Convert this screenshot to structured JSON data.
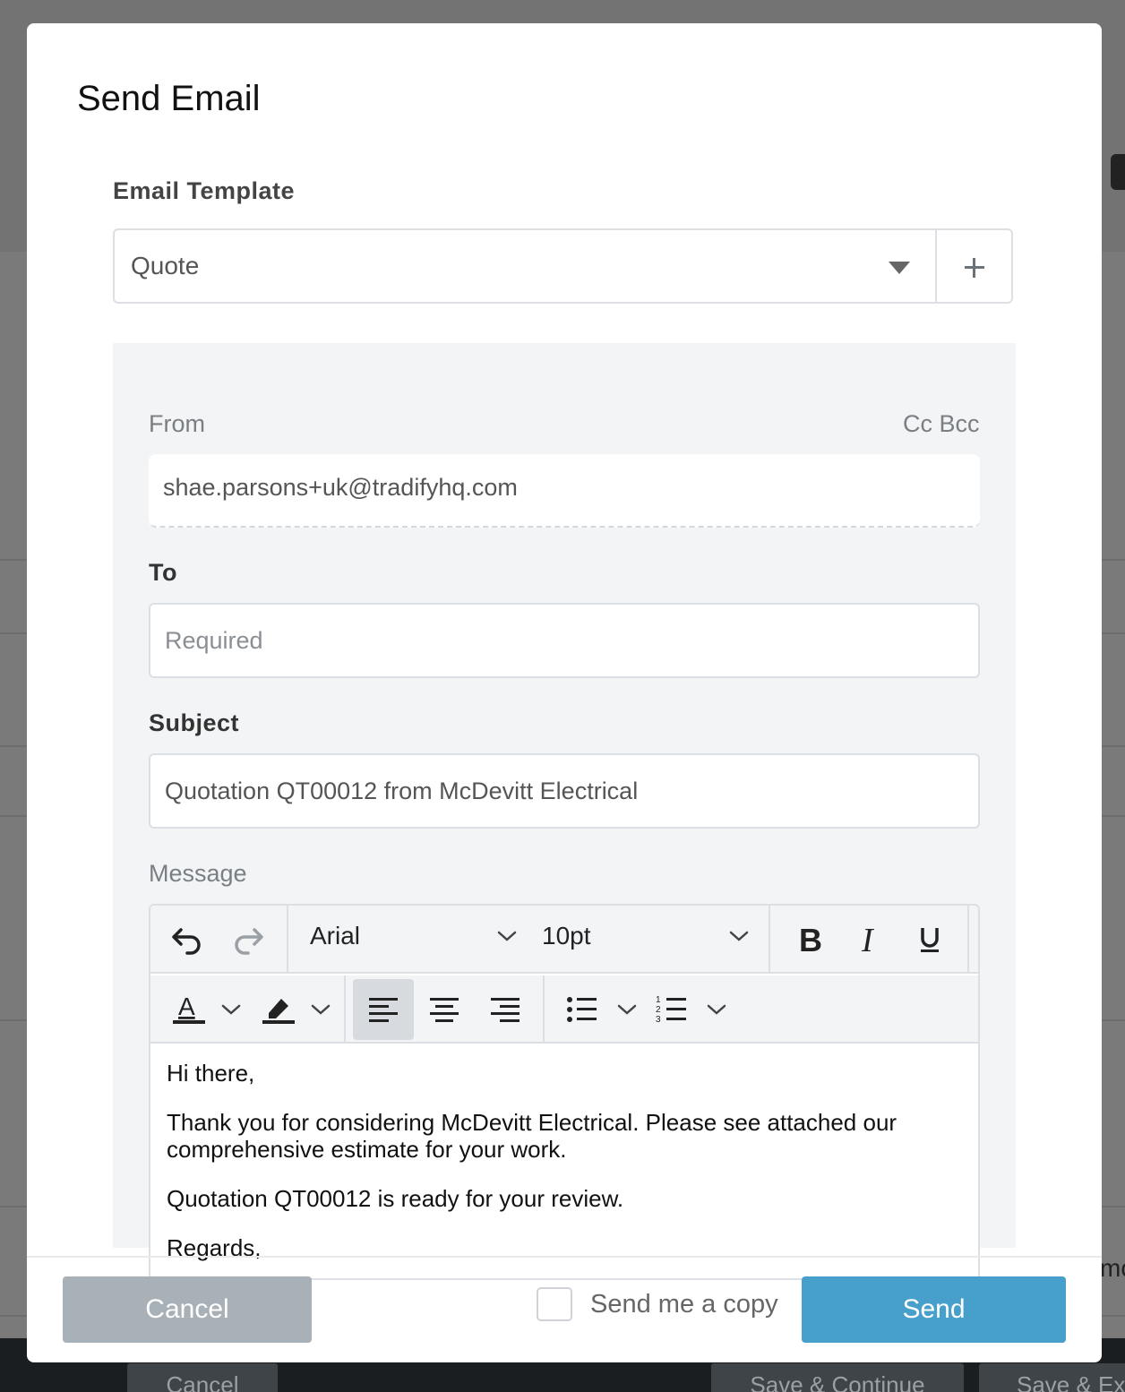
{
  "background": {
    "bottom_buttons": [
      "Cancel",
      "Save & Continue",
      "Save & Ex"
    ],
    "partial_text": "mo"
  },
  "modal": {
    "title": "Send Email",
    "template": {
      "label": "Email Template",
      "selected": "Quote",
      "add_icon": "plus-icon"
    },
    "from": {
      "label": "From",
      "cc_bcc": "Cc Bcc",
      "value": "shae.parsons+uk@tradifyhq.com"
    },
    "to": {
      "label": "To",
      "placeholder": "Required",
      "value": ""
    },
    "subject": {
      "label": "Subject",
      "value": "Quotation QT00012 from McDevitt Electrical"
    },
    "message": {
      "label": "Message",
      "toolbar": {
        "font_family": "Arial",
        "font_size": "10pt",
        "icons": [
          "undo-icon",
          "redo-icon",
          "bold-icon",
          "italic-icon",
          "underline-icon",
          "text-color-icon",
          "highlight-icon",
          "align-left-icon",
          "align-center-icon",
          "align-right-icon",
          "bullet-list-icon",
          "numbered-list-icon"
        ],
        "active_alignment": "left"
      },
      "body": [
        "Hi there,",
        "Thank you for considering McDevitt Electrical. Please see attached our comprehensive estimate for your work.",
        "Quotation QT00012 is ready for your review.",
        "Regards,"
      ]
    },
    "footer": {
      "cancel": "Cancel",
      "send_copy": "Send me a copy",
      "send_copy_checked": false,
      "send": "Send"
    }
  },
  "colors": {
    "overlay": "#7a7a7a",
    "send_button": "#479fcb",
    "cancel_button": "#a8b1b7",
    "panel": "#f2f4f6"
  }
}
